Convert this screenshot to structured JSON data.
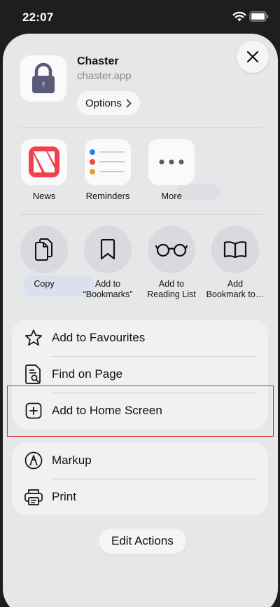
{
  "status_bar": {
    "time": "22:07"
  },
  "share_sheet": {
    "app": {
      "name": "Chaster",
      "domain": "chaster.app",
      "options_label": "Options"
    },
    "apps": [
      {
        "label": "News",
        "icon": "news-icon"
      },
      {
        "label": "Reminders",
        "icon": "reminders-icon"
      },
      {
        "label": "More",
        "icon": "more-icon"
      }
    ],
    "actions": [
      {
        "label": "Copy",
        "icon": "copy-icon"
      },
      {
        "label": "Add to\n“Bookmarks”",
        "icon": "bookmark-icon"
      },
      {
        "label": "Add to\nReading List",
        "icon": "reading-list-icon"
      },
      {
        "label": "Add\nBookmark to…",
        "icon": "book-icon"
      }
    ],
    "menu_group_1": [
      {
        "label": "Add to Favourites",
        "icon": "star-icon"
      },
      {
        "label": "Find on Page",
        "icon": "find-on-page-icon"
      },
      {
        "label": "Add to Home Screen",
        "icon": "add-square-icon"
      }
    ],
    "menu_group_2": [
      {
        "label": "Markup",
        "icon": "markup-icon"
      },
      {
        "label": "Print",
        "icon": "printer-icon"
      }
    ],
    "edit_actions_label": "Edit Actions"
  },
  "colors": {
    "highlight": "#e0242b",
    "news_red": "#f2404f",
    "lock_color": "#5a5a78"
  }
}
